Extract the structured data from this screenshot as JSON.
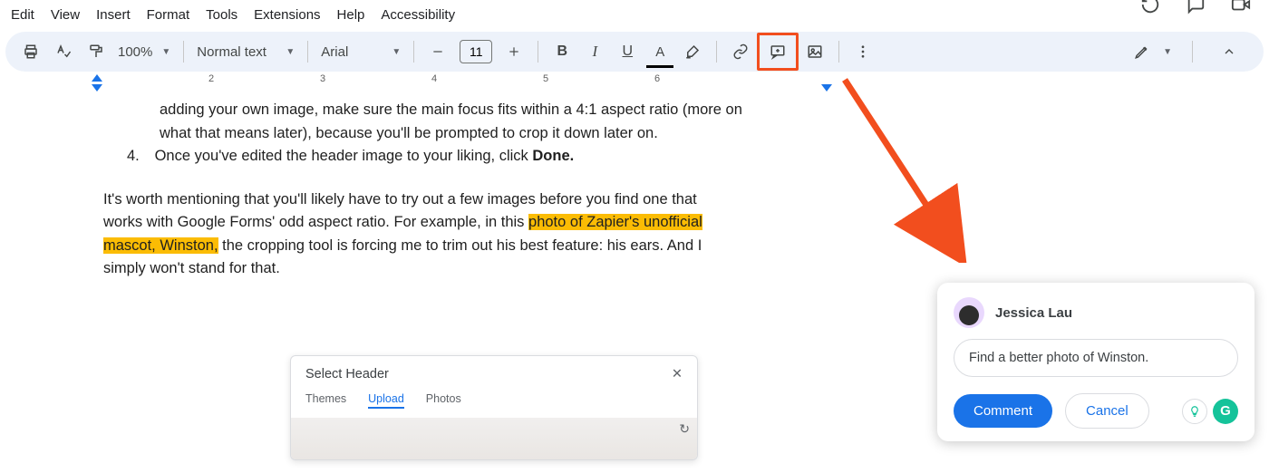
{
  "menubar": [
    "Edit",
    "View",
    "Insert",
    "Format",
    "Tools",
    "Extensions",
    "Help",
    "Accessibility"
  ],
  "toolbar": {
    "zoom": "100%",
    "paragraph_style": "Normal text",
    "font_family": "Arial",
    "font_size": "11",
    "bold_glyph": "B",
    "italic_glyph": "I",
    "underline_glyph": "U",
    "text_color_glyph": "A"
  },
  "ruler": {
    "labels": [
      "2",
      "3",
      "4",
      "5",
      "6"
    ]
  },
  "document": {
    "line1_a": "adding your own image, make sure the main focus fits within a 4:1 aspect ratio (more on",
    "line1_b": "what that means later), because you'll be prompted to crop it down later on.",
    "list_num": "4.",
    "line2_a": "Once you've edited the header image to your liking, click ",
    "line2_bold": "Done.",
    "para2_a": "It's worth mentioning that you'll likely have to try out a few images before you find one that",
    "para2_b": "works with Google Forms' odd aspect ratio. For example, in this ",
    "para2_hi_a": "photo of Zapier's unofficial",
    "para2_hi_b": "mascot, Winston,",
    "para2_c": " the cropping tool is forcing me to trim out his best feature: his ears. And I",
    "para2_d": "simply won't stand for that."
  },
  "embed": {
    "title": "Select Header",
    "close": "✕",
    "tabs": [
      "Themes",
      "Upload",
      "Photos"
    ],
    "active_tab_index": 1,
    "redo_glyph": "↻"
  },
  "comment": {
    "author": "Jessica Lau",
    "text": "Find a better photo of Winston.",
    "primary": "Comment",
    "secondary": "Cancel",
    "grammarly": "G"
  }
}
